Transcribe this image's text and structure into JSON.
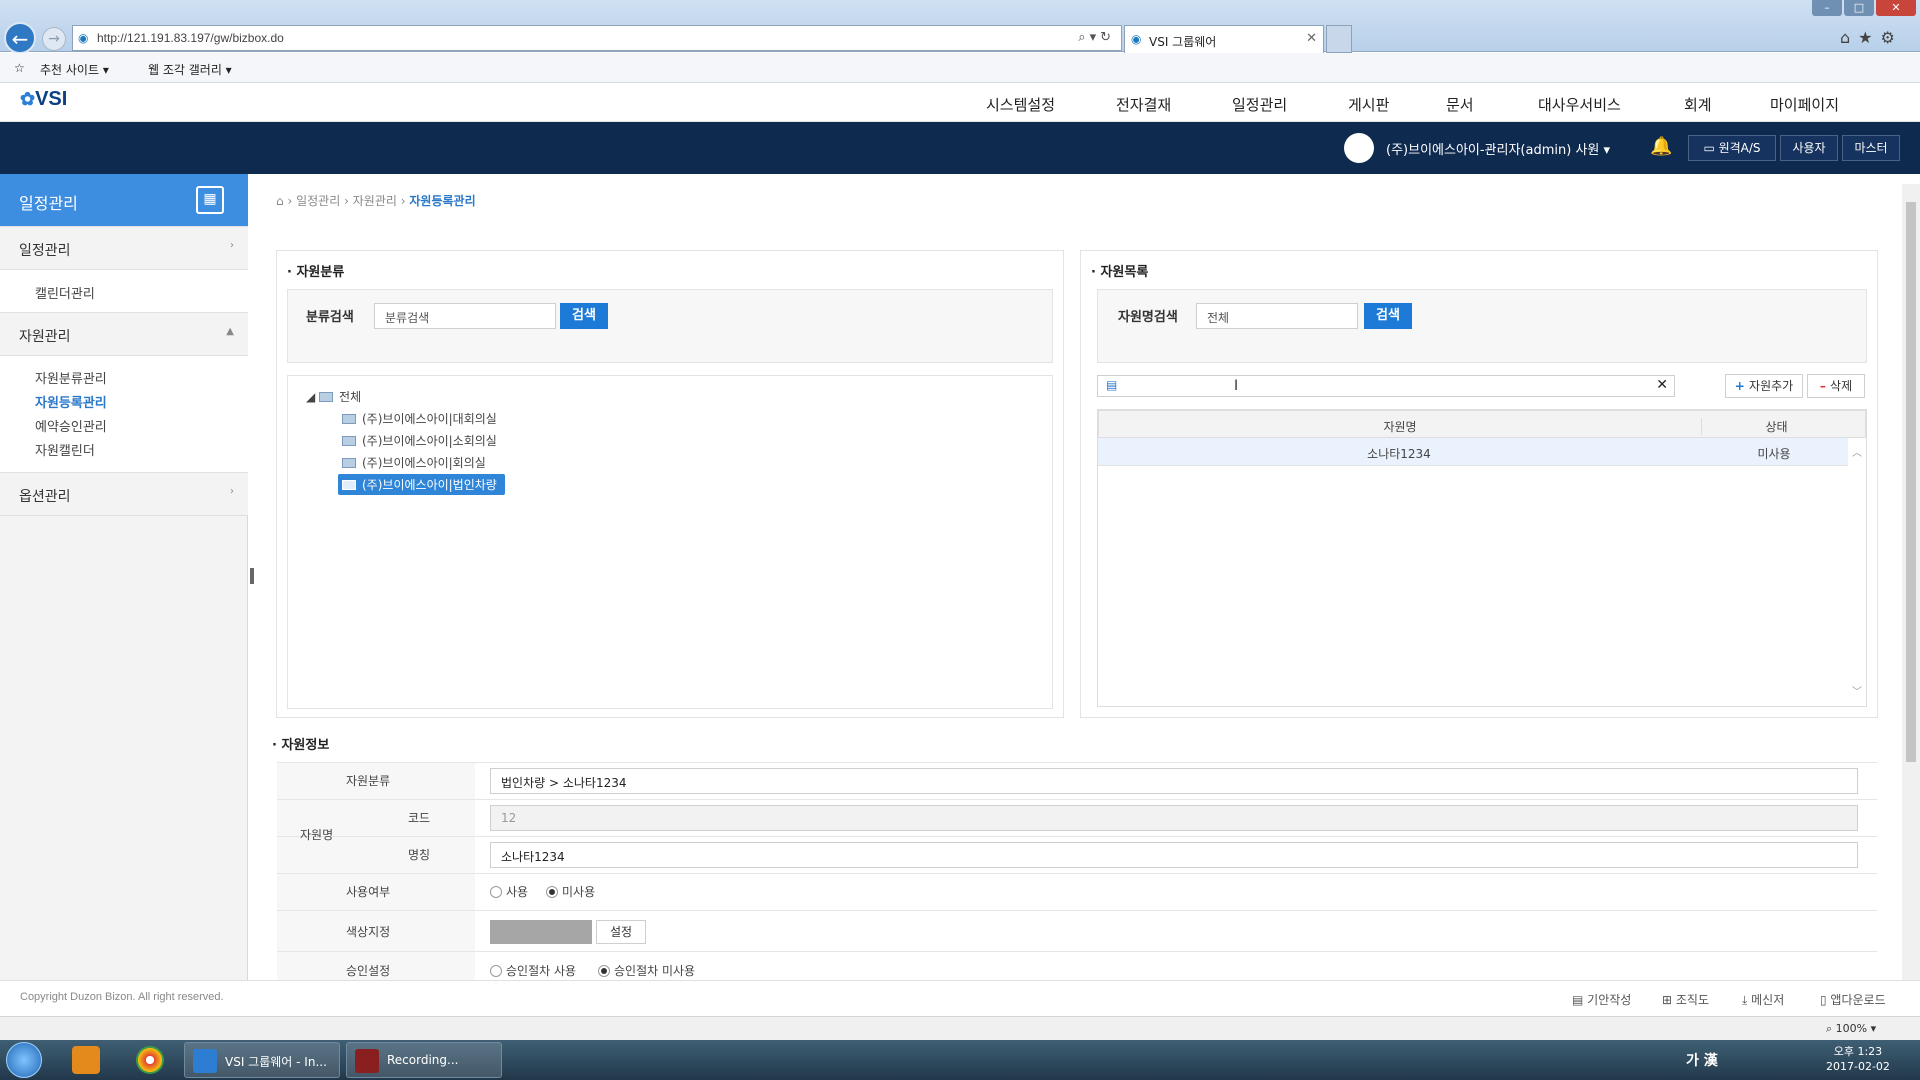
{
  "browser": {
    "url": "http://121.191.83.197/gw/bizbox.do",
    "tab_title": "VSI 그룹웨어",
    "favorites": [
      "추천 사이트 ▾",
      "웹 조각 갤러리 ▾"
    ]
  },
  "header": {
    "logo": "VSI",
    "nav": [
      "시스템설정",
      "전자결재",
      "일정관리",
      "게시판",
      "문서",
      "대사우서비스",
      "회계",
      "마이페이지"
    ],
    "user": "(주)브이에스아이-관리자(admin) 사원 ▾",
    "buttons": [
      "원격A/S",
      "사용자",
      "마스터"
    ]
  },
  "sidebar": {
    "title": "일정관리",
    "groups": [
      {
        "label": "일정관리",
        "items": [
          "캘린더관리"
        ]
      },
      {
        "label": "자원관리",
        "items": [
          "자원분류관리",
          "자원등록관리",
          "예약승인관리",
          "자원캘린더"
        ]
      },
      {
        "label": "옵션관리",
        "items": []
      }
    ]
  },
  "breadcrumb": {
    "home": "⌂",
    "p1": "일정관리",
    "p2": "자원관리",
    "current": "자원등록관리",
    "sep": "›"
  },
  "category": {
    "title": "자원분류",
    "search_label": "분류검색",
    "search_value": "분류검색",
    "search_button": "검색",
    "tree_root": "전체",
    "tree_nodes": [
      "(주)브이에스아이|대회의실",
      "(주)브이에스아이|소회의실",
      "(주)브이에스아이|회의실",
      "(주)브이에스아이|법인차량"
    ]
  },
  "resource_list": {
    "title": "자원목록",
    "search_label": "자원명검색",
    "search_value": "전체",
    "search_button": "검색",
    "add_button": "자원추가",
    "delete_button": "삭제",
    "columns": [
      "자원명",
      "상태"
    ],
    "rows": [
      {
        "name": "소나타1234",
        "status": "미사용"
      }
    ]
  },
  "info": {
    "title": "자원정보",
    "category_label": "자원분류",
    "category_value": "법인차량 > 소나타1234",
    "name_label": "자원명",
    "code_label": "코드",
    "code_value": "12",
    "title_label": "명칭",
    "title_value": "소나타1234",
    "usage_label": "사용여부",
    "usage_options": [
      "사용",
      "미사용"
    ],
    "usage_selected": "미사용",
    "color_label": "색상지정",
    "color_value": "#a6a6a6",
    "color_button": "설정",
    "approval_label": "승인설정",
    "approval_options": [
      "승인절차 사용",
      "승인절차 미사용"
    ],
    "approval_selected": "승인절차 미사용"
  },
  "footer": {
    "copyright": "Copyright Duzon Bizon. All right reserved.",
    "links": [
      "기안작성",
      "조직도",
      "메신저",
      "앱다운로드"
    ]
  },
  "statusbar": {
    "zoom": "100%"
  },
  "taskbar": {
    "tasks": [
      "VSI 그룹웨어 - In...",
      "Recording..."
    ],
    "ime": "가 漢",
    "time": "오후 1:23",
    "date": "2017-02-02"
  }
}
